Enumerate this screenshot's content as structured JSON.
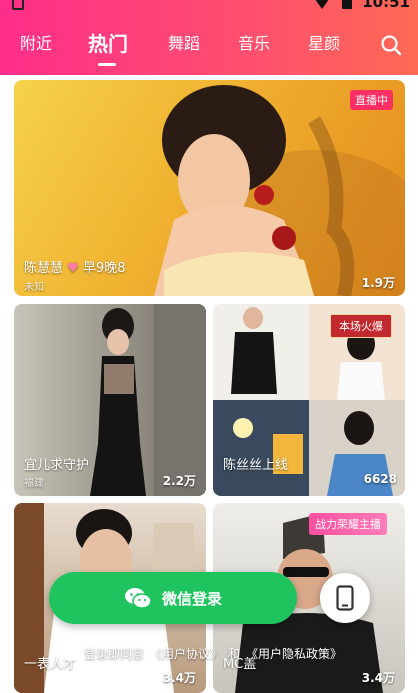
{
  "status_bar": {
    "time": "10:51"
  },
  "nav": {
    "tabs": [
      {
        "label": "附近"
      },
      {
        "label": "热门"
      },
      {
        "label": "舞蹈"
      },
      {
        "label": "音乐"
      },
      {
        "label": "星颜"
      }
    ],
    "active_tab": "热门",
    "search_icon": "search-icon"
  },
  "feed": {
    "featured": {
      "badge": "直播中",
      "title": "陈慧慧",
      "title_suffix": "早9晚8",
      "location": "未知",
      "viewers": "1.9万"
    },
    "cards": [
      {
        "title": "宜儿求守护",
        "location": "福建",
        "viewers": "2.2万"
      },
      {
        "badge": "本场火爆",
        "title": "陈丝丝上线",
        "viewers": "6628"
      },
      {
        "title": "一表人才",
        "viewers": "3.4万"
      },
      {
        "badge": "战力荣耀主播",
        "title": "MC盖",
        "viewers": "3.4万"
      }
    ]
  },
  "login": {
    "wechat_label": "微信登录",
    "agreement_prefix": "登录即同意",
    "user_agreement": "《用户协议》",
    "and": "和",
    "privacy_policy": "《用户隐私政策》"
  },
  "colors": {
    "brand_gradient_start": "#ff2e8a",
    "brand_gradient_end": "#ff6a55",
    "wechat_green": "#1fc45f",
    "live_red": "#ff2e63"
  }
}
